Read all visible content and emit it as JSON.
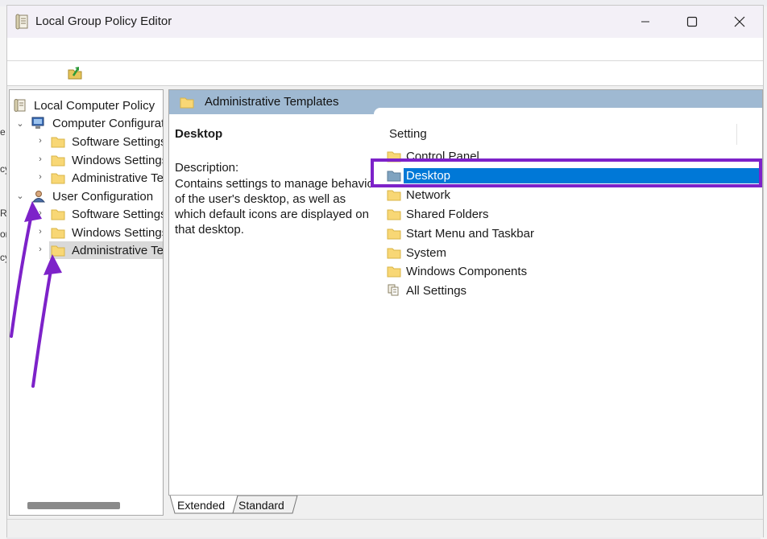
{
  "window": {
    "title": "Local Group Policy Editor"
  },
  "tree": {
    "items": [
      {
        "label": "Local Computer Policy",
        "level": 0
      },
      {
        "label": "Computer Configuration",
        "level": 1
      },
      {
        "label": "Software Settings",
        "level": 2
      },
      {
        "label": "Windows Settings",
        "level": 2
      },
      {
        "label": "Administrative Templates",
        "level": 2
      },
      {
        "label": "User Configuration",
        "level": 1
      },
      {
        "label": "Software Settings",
        "level": 2
      },
      {
        "label": "Windows Settings",
        "level": 2
      },
      {
        "label": "Administrative Templates",
        "level": 2,
        "selected": true
      }
    ]
  },
  "details": {
    "header": "Administrative Templates",
    "title": "Desktop",
    "description_label": "Description:",
    "description": "Contains settings to manage behavior of the user's desktop, as well as which default icons are displayed on that desktop.",
    "column_header": "Setting",
    "items": [
      {
        "label": "Control Panel"
      },
      {
        "label": "Desktop",
        "selected": true
      },
      {
        "label": "Network"
      },
      {
        "label": "Shared Folders"
      },
      {
        "label": "Start Menu and Taskbar"
      },
      {
        "label": "System"
      },
      {
        "label": "Windows Components"
      },
      {
        "label": "All Settings"
      }
    ]
  },
  "tabs": [
    {
      "label": "Extended",
      "active": true
    },
    {
      "label": "Standard",
      "active": false
    }
  ],
  "background": {
    "fragments": [
      "e",
      "cy",
      "R",
      "or",
      "cy"
    ]
  },
  "colors": {
    "selection": "#0078d7",
    "highlight_box": "#7d22c9",
    "arrow": "#7d22c9",
    "header_bar": "#9fb9d2"
  }
}
